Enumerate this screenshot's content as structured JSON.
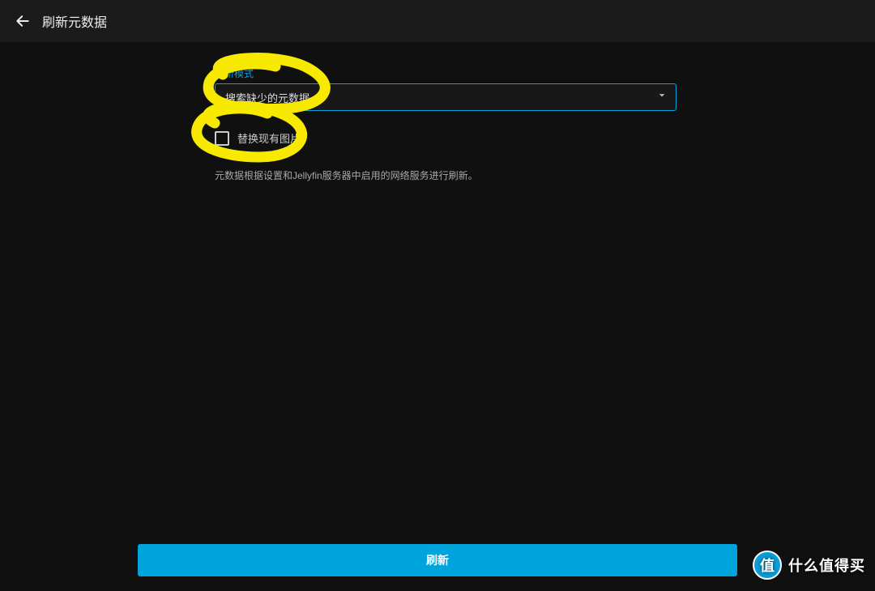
{
  "header": {
    "title": "刷新元数据"
  },
  "form": {
    "mode_label": "刷新模式",
    "mode_value": "搜索缺少的元数据",
    "replace_images_label": "替换现有图片",
    "hint_text": "元数据根据设置和Jellyfin服务器中启用的网络服务进行刷新。"
  },
  "footer": {
    "refresh_button": "刷新"
  },
  "watermark": {
    "badge_char": "值",
    "text": "什么值得买"
  },
  "colors": {
    "accent": "#00a4dc",
    "annotation": "#f7ea00"
  }
}
